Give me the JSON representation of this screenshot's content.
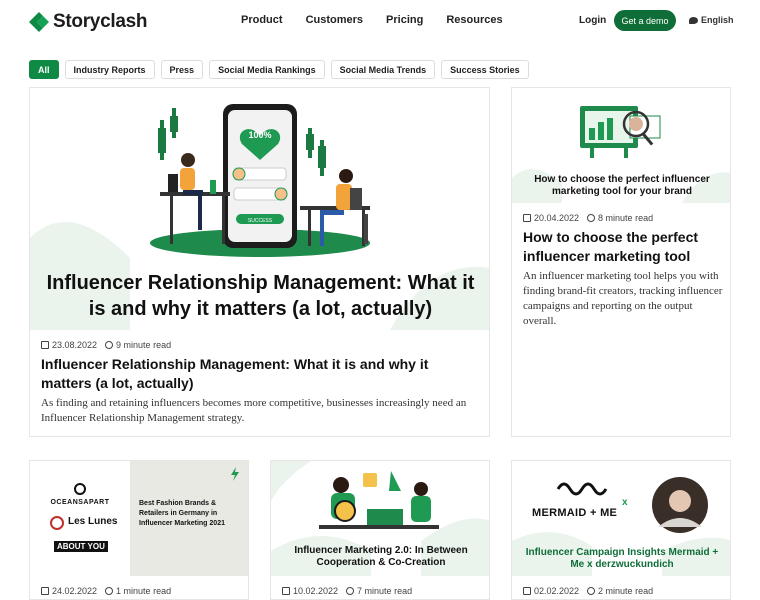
{
  "brand": {
    "name": "Storyclash",
    "green": "#0f8a45",
    "dark_green": "#0f6e38",
    "pale_green": "#e6f2e9"
  },
  "nav": {
    "items": [
      "Product",
      "Customers",
      "Pricing",
      "Resources"
    ],
    "login": "Login",
    "demo": "Get a demo",
    "language": "English"
  },
  "filters": [
    "All",
    "Industry Reports",
    "Press",
    "Social Media Rankings",
    "Social Media Trends",
    "Success Stories"
  ],
  "featured": {
    "image_title": "Influencer Relationship Management: What it is and why it matters (a lot, actually)",
    "image_percent": "100%",
    "image_button": "SUCCESS",
    "date": "23.08.2022",
    "read": "9 minute read",
    "title": "Influencer Relationship Management: What it is and why it matters (a lot, actually)",
    "excerpt": "As finding and retaining influencers becomes more competitive, businesses increasingly need an Influencer Relationship Management strategy."
  },
  "side": {
    "image_title": "How to choose the perfect influencer marketing tool for your brand",
    "date": "20.04.2022",
    "read": "8 minute read",
    "title": "How to choose the perfect influencer marketing tool",
    "excerpt": "An influencer marketing tool helps you with finding brand-fit creators, tracking influencer campaigns and reporting on the output overall."
  },
  "bottom": [
    {
      "brands": [
        "OCEANSAPART",
        "Les Lunes",
        "ABOUT YOU"
      ],
      "image_title": "Best Fashion Brands & Retailers in Germany in Influencer Marketing 2021",
      "date": "24.02.2022",
      "read": "1 minute read"
    },
    {
      "image_title": "Influencer Marketing 2.0: In Between Cooperation & Co-Creation",
      "date": "10.02.2022",
      "read": "7 minute read"
    },
    {
      "brand": "MERMAID + ME",
      "x_mark": "x",
      "image_title": "Influencer Campaign Insights Mermaid + Me x derzwuckundich",
      "date": "02.02.2022",
      "read": "2 minute read"
    }
  ]
}
